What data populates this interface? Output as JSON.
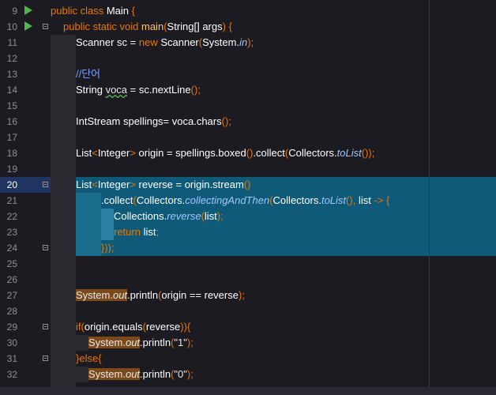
{
  "editor": {
    "language": "java",
    "current_line": 20,
    "lines": [
      {
        "n": "9",
        "text": "public class Main {"
      },
      {
        "n": "10",
        "text": "public static void main(String[] args) {"
      },
      {
        "n": "11",
        "text": "Scanner sc = new Scanner(System.in);"
      },
      {
        "n": "12",
        "text": ""
      },
      {
        "n": "13",
        "text": "//단어"
      },
      {
        "n": "14",
        "text": "String voca = sc.nextLine();"
      },
      {
        "n": "15",
        "text": ""
      },
      {
        "n": "16",
        "text": "IntStream spellings= voca.chars();"
      },
      {
        "n": "17",
        "text": ""
      },
      {
        "n": "18",
        "text": "List<Integer> origin = spellings.boxed().collect(Collectors.toList());"
      },
      {
        "n": "19",
        "text": ""
      },
      {
        "n": "20",
        "text": "List<Integer> reverse = origin.stream()"
      },
      {
        "n": "21",
        "text": ".collect(Collectors.collectingAndThen(Collectors.toList(), list -> {"
      },
      {
        "n": "22",
        "text": "Collections.reverse(list);"
      },
      {
        "n": "23",
        "text": "return list;"
      },
      {
        "n": "24",
        "text": "}));"
      },
      {
        "n": "25",
        "text": ""
      },
      {
        "n": "26",
        "text": ""
      },
      {
        "n": "27",
        "text": "System.out.println(origin == reverse);"
      },
      {
        "n": "28",
        "text": ""
      },
      {
        "n": "29",
        "text": "if(origin.equals(reverse)){"
      },
      {
        "n": "30",
        "text": "System.out.println(\"1\");"
      },
      {
        "n": "31",
        "text": "}else{"
      },
      {
        "n": "32",
        "text": "System.out.println(\"0\");"
      }
    ]
  },
  "colors": {
    "background": "#1c1b22",
    "selection": "#0f5a78",
    "keyword": "#ec7600",
    "method": "#ffc66d",
    "run_icon": "#4fb84c"
  },
  "icons": [
    "run-icon",
    "fold-icon"
  ]
}
